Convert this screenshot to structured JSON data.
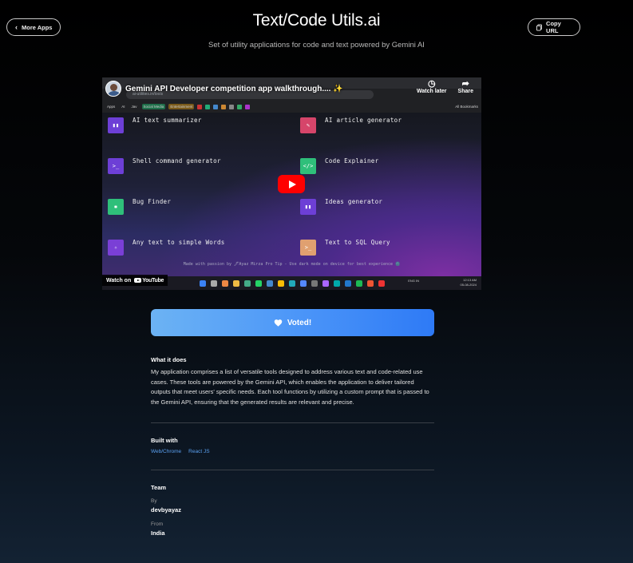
{
  "header": {
    "more_apps": "More Apps",
    "title": "Text/Code Utils.ai",
    "subtitle": "Set of utility applications for code and text powered by Gemini AI",
    "copy_url": "Copy URL"
  },
  "video": {
    "title": "Gemini API Developer competition app walkthrough.... ✨",
    "watch_later": "Watch later",
    "share": "Share",
    "url": "ai-utilities.in/tools",
    "bookmarks": [
      "Apps",
      "AI",
      "Jav",
      "Social Media",
      "Entertainment",
      "All Bookmarks"
    ],
    "tools": [
      {
        "label": "AI text summarizer",
        "color": "#6d3fd6",
        "glyph": "▮▮"
      },
      {
        "label": "AI article generator",
        "color": "#d6456a",
        "glyph": "✎"
      },
      {
        "label": "Shell command generator",
        "color": "#6d3fd6",
        "glyph": ">_"
      },
      {
        "label": "Code Explainer",
        "color": "#2fbf7a",
        "glyph": "</>"
      },
      {
        "label": "Bug Finder",
        "color": "#2fbf7a",
        "glyph": "✱"
      },
      {
        "label": "Ideas generator",
        "color": "#6d3fd6",
        "glyph": "▮▮"
      },
      {
        "label": "Any text to simple Words",
        "color": "#7a3fd6",
        "glyph": "✧"
      },
      {
        "label": "Text to SQL Query",
        "color": "#e0a070",
        "glyph": ">_"
      }
    ],
    "footer": "Made with passion by 🖋Ayaz Mirza Pro Tip - Use dark mode on device for best experience 🌚",
    "watch_on": "Watch on",
    "youtube": "YouTube",
    "tray_lang": "ENG\nIN",
    "tray_time": "12:13 AM",
    "tray_date": "05-08-2024"
  },
  "vote": {
    "label": "Voted!"
  },
  "what_it_does": {
    "heading": "What it does",
    "body": "My application comprises a list of versatile tools designed to address various text and code-related use cases. These tools are powered by the Gemini API, which enables the application to deliver tailored outputs that meet users' specific needs. Each tool functions by utilizing a custom prompt that is passed to the Gemini API, ensuring that the generated results are relevant and precise."
  },
  "built_with": {
    "heading": "Built with",
    "tags": [
      "Web/Chrome",
      "React JS"
    ]
  },
  "team": {
    "heading": "Team",
    "by_label": "By",
    "by_value": "devbyayaz",
    "from_label": "From",
    "from_value": "India"
  }
}
